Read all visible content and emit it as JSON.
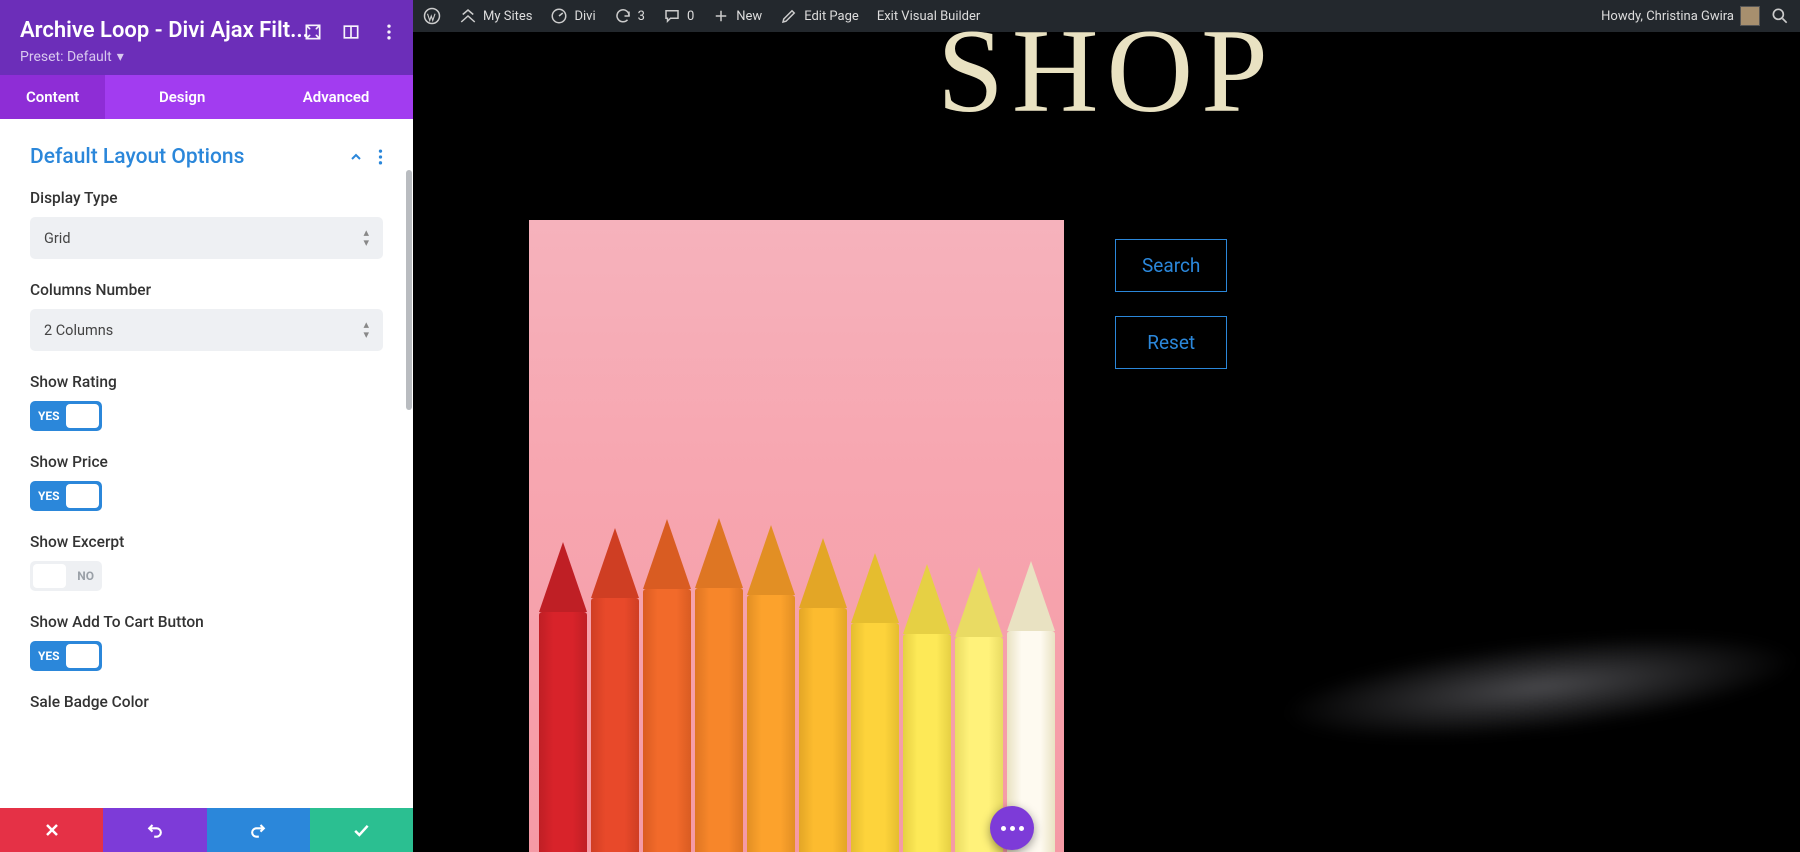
{
  "panel": {
    "title": "Archive Loop - Divi Ajax Filt...",
    "preset_label": "Preset: Default",
    "tabs": [
      "Content",
      "Design",
      "Advanced"
    ],
    "section_title": "Default Layout Options",
    "fields": {
      "display_type": {
        "label": "Display Type",
        "value": "Grid"
      },
      "columns_number": {
        "label": "Columns Number",
        "value": "2 Columns"
      },
      "show_rating": {
        "label": "Show Rating",
        "on": true,
        "yes": "YES"
      },
      "show_price": {
        "label": "Show Price",
        "on": true,
        "yes": "YES"
      },
      "show_excerpt": {
        "label": "Show Excerpt",
        "on": false,
        "no": "NO"
      },
      "show_add_to_cart": {
        "label": "Show Add To Cart Button",
        "on": true,
        "yes": "YES"
      },
      "sale_badge_color": {
        "label": "Sale Badge Color"
      }
    }
  },
  "wpbar": {
    "my_sites": "My Sites",
    "site_name": "Divi",
    "updates": "3",
    "comments": "0",
    "new": "New",
    "edit_page": "Edit Page",
    "exit_builder": "Exit Visual Builder",
    "howdy": "Howdy, Christina Gwira"
  },
  "stage": {
    "heading": "SHOP",
    "search_btn": "Search",
    "reset_btn": "Reset"
  },
  "colors": {
    "pencils": [
      {
        "body": "#d8232a",
        "tip": "#bf1f25"
      },
      {
        "body": "#e8492a",
        "tip": "#cf3e23"
      },
      {
        "body": "#f26a2a",
        "tip": "#d95c22"
      },
      {
        "body": "#f7862a",
        "tip": "#de7623"
      },
      {
        "body": "#fca22c",
        "tip": "#e28f24"
      },
      {
        "body": "#fcbb2f",
        "tip": "#e3a626"
      },
      {
        "body": "#fdd33b",
        "tip": "#e5bd2f"
      },
      {
        "body": "#fde957",
        "tip": "#e6d044"
      },
      {
        "body": "#fff27a",
        "tip": "#e9db63"
      },
      {
        "body": "#fefaf0",
        "tip": "#e9e2c2"
      }
    ]
  }
}
